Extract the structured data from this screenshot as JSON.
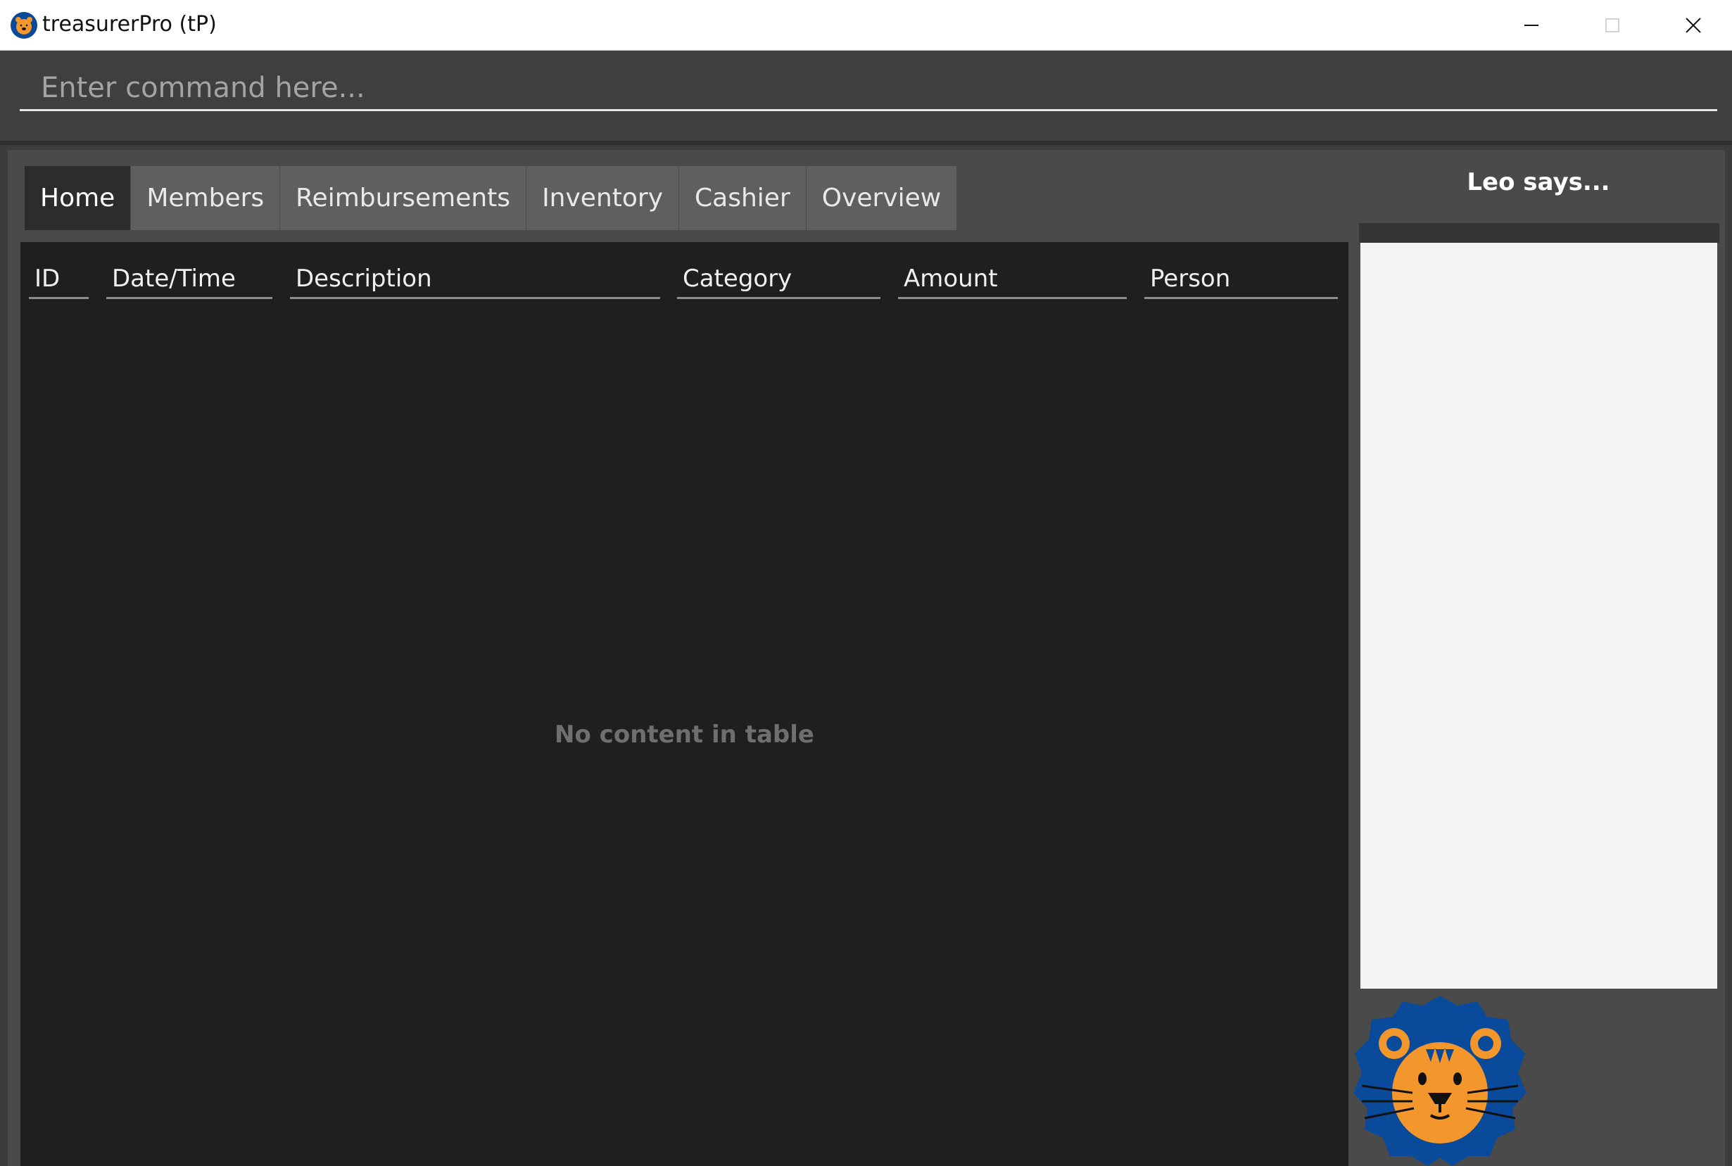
{
  "window": {
    "title": "treasurerPro (tP)",
    "icon": "lion-icon",
    "controls": [
      "minimize-icon",
      "maximize-icon",
      "close-icon"
    ]
  },
  "command": {
    "placeholder": "Enter command here..."
  },
  "tabs": [
    {
      "label": "Home",
      "active": true
    },
    {
      "label": "Members",
      "active": false
    },
    {
      "label": "Reimbursements",
      "active": false
    },
    {
      "label": "Inventory",
      "active": false
    },
    {
      "label": "Cashier",
      "active": false
    },
    {
      "label": "Overview",
      "active": false
    }
  ],
  "table": {
    "columns": [
      "ID",
      "Date/Time",
      "Description",
      "Category",
      "Amount",
      "Person"
    ],
    "empty_message": "No content in table"
  },
  "leo": {
    "title": "Leo says...",
    "message": "",
    "mascot": "lion-mascot-icon"
  },
  "colors": {
    "accent_blue": "#0a4a9a",
    "lion_orange": "#f3962b"
  }
}
